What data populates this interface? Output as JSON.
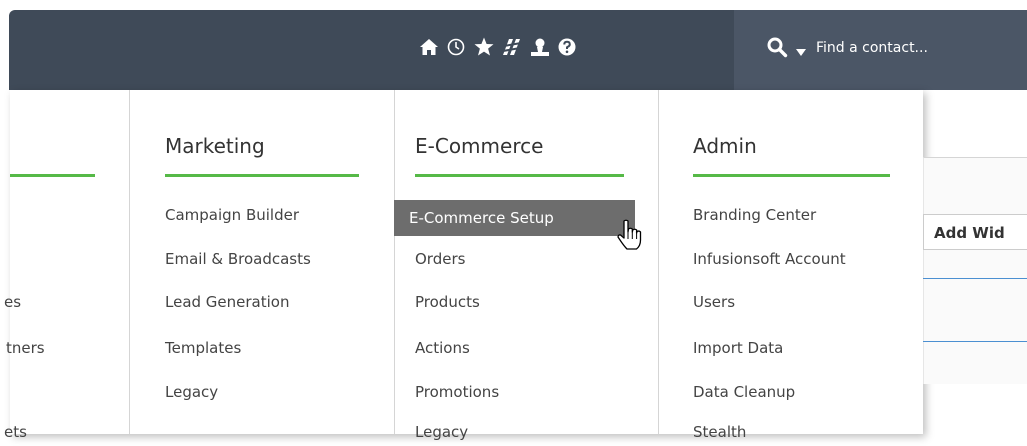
{
  "search": {
    "placeholder": "Find a contact..."
  },
  "nav_icons": [
    "home-icon",
    "recent-icon",
    "favorites-icon",
    "news-icon",
    "user-icon",
    "help-icon"
  ],
  "menu": {
    "columns": [
      {
        "heading": "",
        "items": [
          "",
          "",
          "es",
          "tners",
          "",
          "ets"
        ]
      },
      {
        "heading": "Marketing",
        "items": [
          "Campaign Builder",
          "Email & Broadcasts",
          "Lead Generation",
          "Templates",
          "Legacy"
        ]
      },
      {
        "heading": "E-Commerce",
        "items": [
          "E-Commerce Setup",
          "Orders",
          "Products",
          "Actions",
          "Promotions",
          "Legacy"
        ]
      },
      {
        "heading": "Admin",
        "items": [
          "Branding Center",
          "Infusionsoft Account",
          "Users",
          "Import Data",
          "Data Cleanup",
          "Stealth"
        ]
      }
    ],
    "active_item": "E-Commerce Setup"
  },
  "widgets": {
    "add_label": "Add Wid"
  },
  "colors": {
    "nav_bg": "#3f4a58",
    "accent_green": "#56b947",
    "active_bg": "#6d6d6d"
  }
}
